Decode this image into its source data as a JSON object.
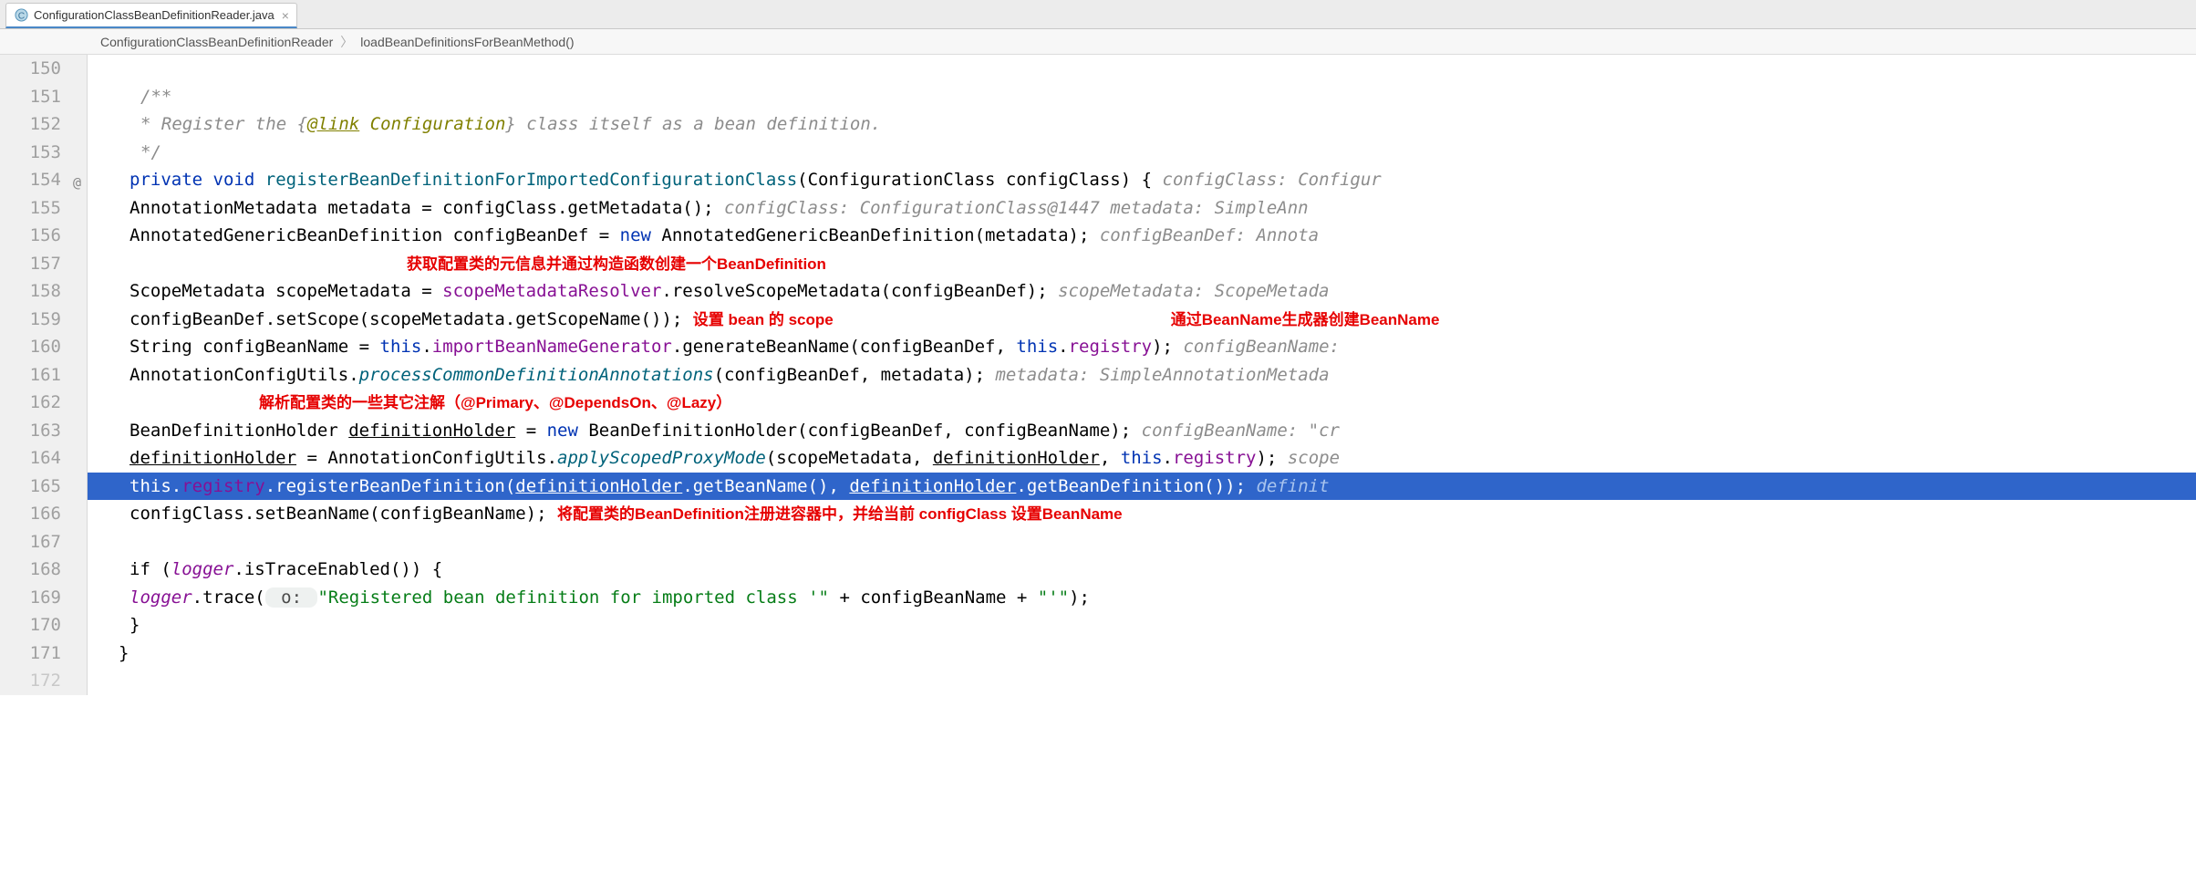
{
  "tab": {
    "filename": "ConfigurationClassBeanDefinitionReader.java",
    "close": "×"
  },
  "crumbs": {
    "a": "ConfigurationClassBeanDefinitionReader",
    "b": "loadBeanDefinitionsForBeanMethod()",
    "sep": "〉"
  },
  "ln": {
    "l150": "150",
    "l151": "151",
    "l152": "152",
    "l153": "153",
    "l154": "154",
    "l155": "155",
    "l156": "156",
    "l157": "157",
    "l158": "158",
    "l159": "159",
    "l160": "160",
    "l161": "161",
    "l162": "162",
    "l163": "163",
    "l164": "164",
    "l165": "165",
    "l166": "166",
    "l167": "167",
    "l168": "168",
    "l169": "169",
    "l170": "170",
    "l171": "171",
    "l172": "172"
  },
  "gm": {
    "at": "@"
  },
  "t": {
    "jd1": "/**",
    "jd2_a": " * Register the {",
    "jd2_b": "@link",
    "jd2_c": " ",
    "jd2_d": "Configuration",
    "jd2_e": "} class itself as a bean definition.",
    "jd3": " */",
    "l154_a": "private",
    "l154_b": " ",
    "l154_c": "void",
    "l154_d": " ",
    "l154_e": "registerBeanDefinitionForImportedConfigurationClass",
    "l154_f": "(ConfigurationClass configClass) {   ",
    "l154_g": "configClass: Configur",
    "l155_a": "    AnnotationMetadata metadata = configClass.getMetadata();   ",
    "l155_b": "configClass: ConfigurationClass@1447    metadata: SimpleAnn",
    "l156_a": "    AnnotatedGenericBeanDefinition configBeanDef = ",
    "l156_b": "new",
    "l156_c": " AnnotatedGenericBeanDefinition(metadata);   ",
    "l156_d": "configBeanDef: Annota",
    "l157_red": "获取配置类的元信息并通过构造函数创建一个BeanDefinition",
    "l158_a": "    ScopeMetadata scopeMetadata = ",
    "l158_b": "scopeMetadataResolver",
    "l158_c": ".resolveScopeMetadata(configBeanDef);   ",
    "l158_d": "scopeMetadata: ScopeMetada",
    "l159_a": "    configBeanDef.setScope(scopeMetadata.getScopeName());  ",
    "l159_red": "设置 bean 的 scope",
    "l159_red2": "通过BeanName生成器创建BeanName",
    "l160_a": "    String configBeanName = ",
    "l160_b": "this",
    "l160_c": ".",
    "l160_d": "importBeanNameGenerator",
    "l160_e": ".generateBeanName(configBeanDef, ",
    "l160_f": "this",
    "l160_g": ".",
    "l160_h": "registry",
    "l160_i": ");   ",
    "l160_j": "configBeanName:",
    "l161_a": "    AnnotationConfigUtils.",
    "l161_b": "processCommonDefinitionAnnotations",
    "l161_c": "(configBeanDef, metadata);   ",
    "l161_d": "metadata: SimpleAnnotationMetada",
    "l162_red": "解析配置类的一些其它注解（@Primary、@DependsOn、@Lazy）",
    "l163_a": "    BeanDefinitionHolder ",
    "l163_b": "definitionHolder",
    "l163_c": " = ",
    "l163_d": "new",
    "l163_e": " BeanDefinitionHolder(configBeanDef, configBeanName);   ",
    "l163_f": "configBeanName: \"cr",
    "l164_a": "    ",
    "l164_b": "definitionHolder",
    "l164_c": " = AnnotationConfigUtils.",
    "l164_d": "applyScopedProxyMode",
    "l164_e": "(scopeMetadata, ",
    "l164_f": "definitionHolder",
    "l164_g": ", ",
    "l164_h": "this",
    "l164_i": ".",
    "l164_j": "registry",
    "l164_k": ");   ",
    "l164_l": "scope",
    "l165_a": "    ",
    "l165_b": "this",
    "l165_c": ".",
    "l165_d": "registry",
    "l165_e": ".registerBeanDefinition(",
    "l165_f": "definitionHolder",
    "l165_g": ".getBeanName(), ",
    "l165_h": "definitionHolder",
    "l165_i": ".getBeanDefinition());   ",
    "l165_j": "definit",
    "l166_a": "    configClass.setBeanName(configBeanName);     ",
    "l166_red": "将配置类的BeanDefinition注册进容器中，并给当前 configClass 设置BeanName",
    "l168_a": "    if (",
    "l168_b": "logger",
    "l168_c": ".isTraceEnabled()) {",
    "l169_a": "        ",
    "l169_b": "logger",
    "l169_c": ".trace(",
    "l169_p": " o: ",
    "l169_d": "\"Registered bean definition for imported class '\"",
    "l169_e": " + configBeanName + ",
    "l169_f": "\"'\"",
    "l169_g": ");",
    "l170_a": "    }",
    "l171_a": "}"
  }
}
